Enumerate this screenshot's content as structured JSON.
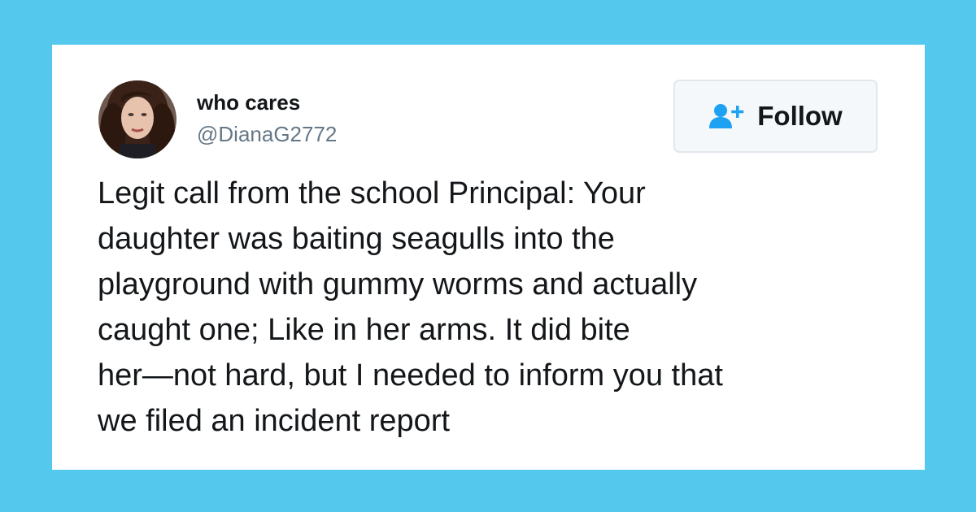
{
  "colors": {
    "background": "#55c8ee",
    "card": "#ffffff",
    "name_text": "#14171a",
    "handle_text": "#657786",
    "accent": "#1da1f2",
    "button_bg": "#f5f8fa",
    "button_border": "#e1e8ed"
  },
  "tweet": {
    "author": {
      "display_name": "who cares",
      "handle": "@DianaG2772",
      "avatar_icon": "user-avatar-photo"
    },
    "follow_button": {
      "icon": "add-user-icon",
      "label": "Follow"
    },
    "text_lines": [
      "Legit call from the school Principal: Your",
      "daughter was baiting seagulls into the",
      "playground with gummy worms and actually",
      "caught one; Like in her arms. It did bite",
      "her—not hard, but I needed to inform you that",
      "we filed an incident report"
    ]
  }
}
